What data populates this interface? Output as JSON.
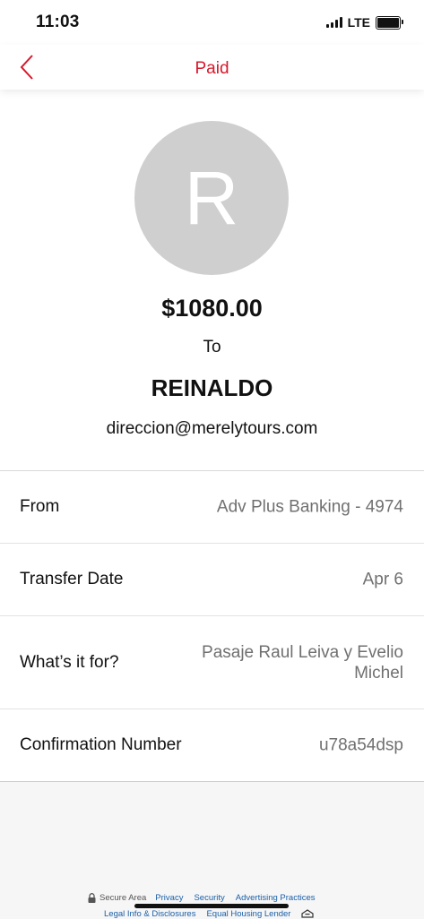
{
  "status_bar": {
    "time": "11:03",
    "network": "LTE"
  },
  "nav": {
    "title": "Paid"
  },
  "payment": {
    "avatar_letter": "R",
    "amount": "$1080.00",
    "to_label": "To",
    "recipient_name": "REINALDO",
    "recipient_email": "direccion@merelytours.com"
  },
  "details": {
    "from": {
      "label": "From",
      "value": "Adv Plus Banking - 4974"
    },
    "transfer_date": {
      "label": "Transfer Date",
      "value": "Apr 6"
    },
    "purpose": {
      "label": "What’s it for?",
      "value": "Pasaje Raul Leiva y Evelio Michel"
    },
    "confirmation": {
      "label": "Confirmation Number",
      "value": "u78a54dsp"
    }
  },
  "footer": {
    "secure_area": "Secure Area",
    "links": [
      "Privacy",
      "Security",
      "Advertising Practices"
    ],
    "links2": [
      "Legal Info & Disclosures",
      "Equal Housing Lender"
    ]
  },
  "colors": {
    "accent": "#d7182a",
    "avatar_bg": "#cfcfcf",
    "link": "#1a5fa8"
  },
  "icons": [
    "signal-icon",
    "battery-icon",
    "back-chevron-icon",
    "lock-icon",
    "equal-housing-icon"
  ]
}
